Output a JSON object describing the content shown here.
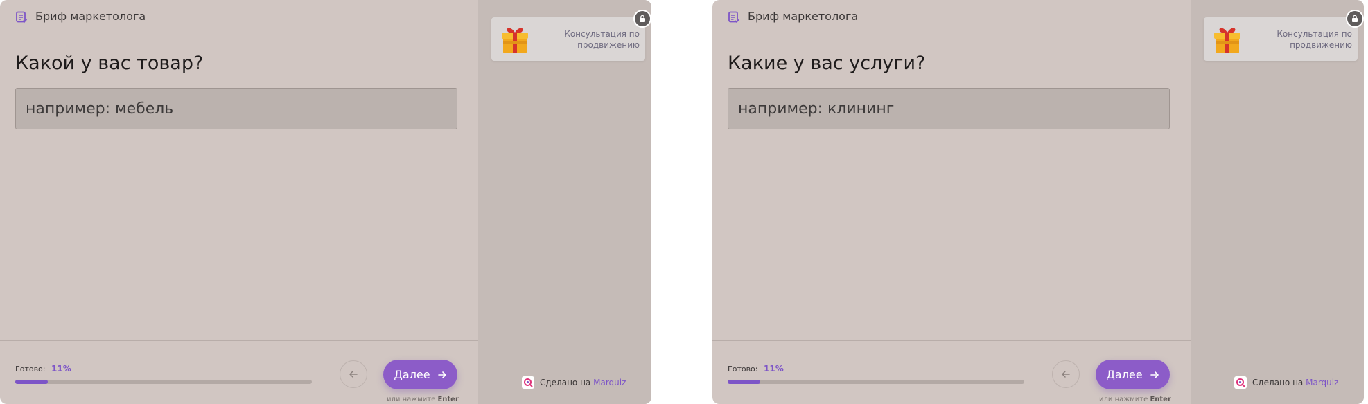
{
  "colors": {
    "accent": "#8c5cc8",
    "panel_bg": "#d1c6c2",
    "sidebar_bg": "#c5bbb7",
    "input_bg": "#bbb2ae"
  },
  "panels": [
    {
      "header": {
        "title": "Бриф маркетолога",
        "icon": "document-icon"
      },
      "question": "Какой у вас товар?",
      "answer": {
        "value": "",
        "placeholder": "например: мебель"
      },
      "progress": {
        "label": "Готово:",
        "value_text": "11%",
        "fraction": 0.11
      },
      "nav": {
        "back_icon": "arrow-left-icon",
        "next_label": "Далее",
        "next_icon": "arrow-right-icon"
      },
      "enter_hint": {
        "prefix": "или нажмите",
        "key": "Enter"
      },
      "sidebar": {
        "promo": {
          "icon": "gift-icon",
          "text": "Консультация по продвижению",
          "lock_icon": "lock-icon"
        },
        "made_by": {
          "prefix": "Сделано на",
          "brand": "Marquiz",
          "icon": "marquiz-logo-icon"
        }
      }
    },
    {
      "header": {
        "title": "Бриф маркетолога",
        "icon": "document-icon"
      },
      "question": "Какие у вас услуги?",
      "answer": {
        "value": "",
        "placeholder": "например: клининг"
      },
      "progress": {
        "label": "Готово:",
        "value_text": "11%",
        "fraction": 0.11
      },
      "nav": {
        "back_icon": "arrow-left-icon",
        "next_label": "Далее",
        "next_icon": "arrow-right-icon"
      },
      "enter_hint": {
        "prefix": "или нажмите",
        "key": "Enter"
      },
      "sidebar": {
        "promo": {
          "icon": "gift-icon",
          "text": "Консультация по продвижению",
          "lock_icon": "lock-icon"
        },
        "made_by": {
          "prefix": "Сделано на",
          "brand": "Marquiz",
          "icon": "marquiz-logo-icon"
        }
      }
    }
  ]
}
